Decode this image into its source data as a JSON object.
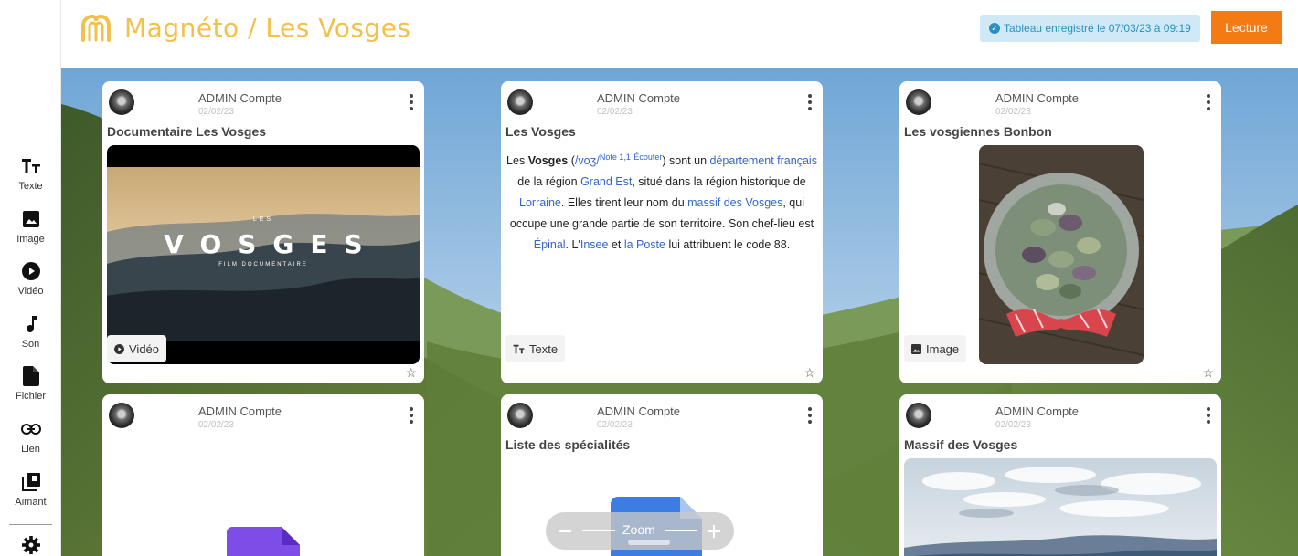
{
  "header": {
    "title": "Magnéto / Les Vosges",
    "save_status": "Tableau enregistré le 07/03/23 à 09:19",
    "play_button": "Lecture",
    "accent_color": "#f2c149",
    "button_color": "#f47a14"
  },
  "sidebar": {
    "items": [
      {
        "label": "Texte",
        "icon": "text-icon"
      },
      {
        "label": "Image",
        "icon": "image-icon"
      },
      {
        "label": "Vidéo",
        "icon": "play-circle-icon"
      },
      {
        "label": "Son",
        "icon": "music-note-icon"
      },
      {
        "label": "Fichier",
        "icon": "file-icon"
      },
      {
        "label": "Lien",
        "icon": "link-icon"
      },
      {
        "label": "Aimant",
        "icon": "stack-icon"
      }
    ],
    "settings_icon": "gear-icon"
  },
  "cards": [
    {
      "author": "ADMIN Compte",
      "date": "02/02/23",
      "title": "Documentaire Les Vosges",
      "type": "Vidéo",
      "video_title": "VOSGES",
      "video_small_top": "LES",
      "video_subtitle": "FILM DOCUMENTAIRE"
    },
    {
      "author": "ADMIN Compte",
      "date": "02/02/23",
      "title": "Les Vosges",
      "type": "Texte",
      "text": {
        "p1": "Les ",
        "bold": "Vosges",
        "p2": " (",
        "ipa": "/voʒ/",
        "note": "Note 1,1",
        "listen": "Écouter",
        "p3": ") sont un ",
        "link1": "département français",
        "p4": " de la région ",
        "link2": "Grand Est",
        "p5": ", situé dans la région historique de ",
        "link3": "Lorraine",
        "p6": ". Elles tirent leur nom du ",
        "link4": "massif des Vosges",
        "p7": ", qui occupe une grande partie de son territoire. Son chef-lieu est ",
        "link5": "Épinal",
        "p8": ". L'",
        "link6": "Insee",
        "p9": " et ",
        "link7": "la Poste",
        "p10": " lui attribuent le code 88."
      }
    },
    {
      "author": "ADMIN Compte",
      "date": "02/02/23",
      "title": "Les vosgiennes Bonbon",
      "type": "Image"
    },
    {
      "author": "ADMIN Compte",
      "date": "02/02/23",
      "title": ""
    },
    {
      "author": "ADMIN Compte",
      "date": "02/02/23",
      "title": "Liste des spécialités"
    },
    {
      "author": "ADMIN Compte",
      "date": "02/02/23",
      "title": "Massif des Vosges"
    }
  ],
  "zoom": {
    "label": "Zoom"
  }
}
